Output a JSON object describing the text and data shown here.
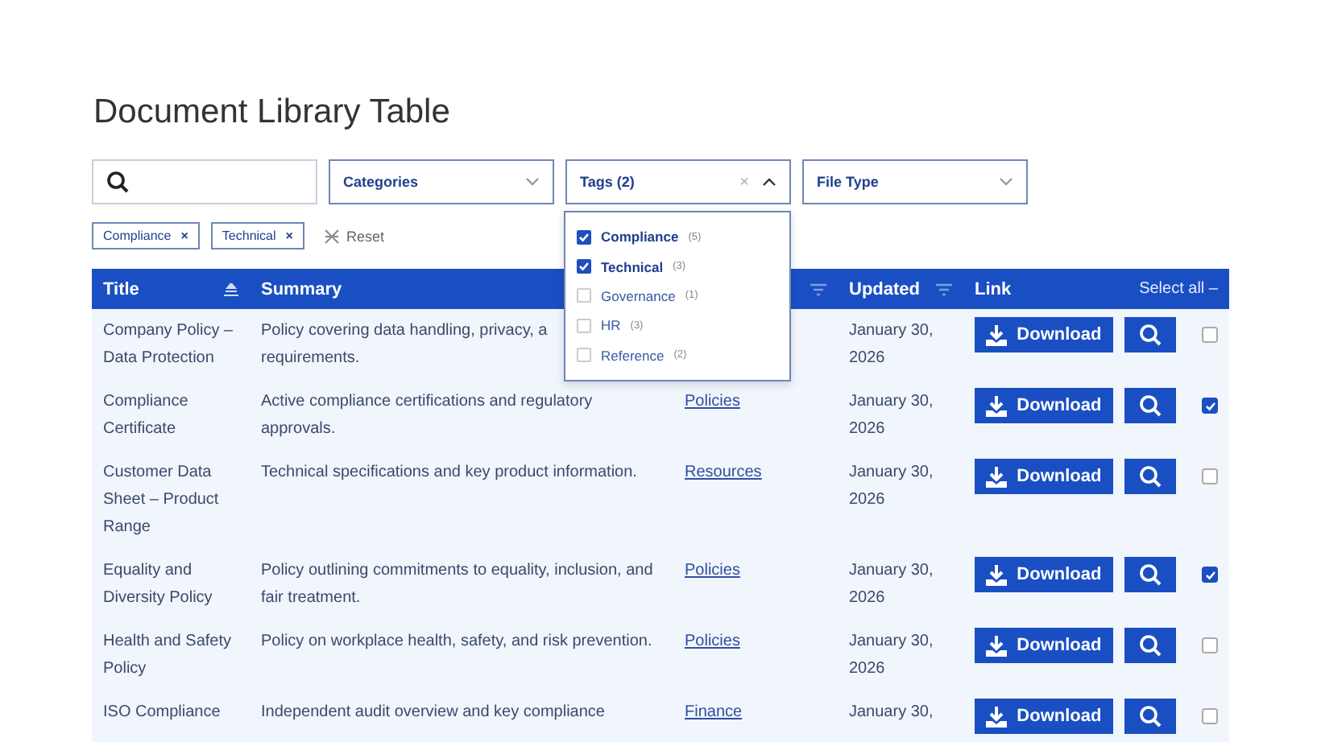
{
  "title": "Document Library Table",
  "filters": {
    "categories": {
      "label": "Categories"
    },
    "tags": {
      "label": "Tags (2)",
      "clear": "×",
      "expanded": true
    },
    "file_type": {
      "label": "File Type"
    }
  },
  "tag_options": [
    {
      "label": "Compliance",
      "count": "(5)",
      "checked": true
    },
    {
      "label": "Technical",
      "count": "(3)",
      "checked": true
    },
    {
      "label": "Governance",
      "count": "(1)",
      "checked": false
    },
    {
      "label": "HR",
      "count": "(3)",
      "checked": false
    },
    {
      "label": "Reference",
      "count": "(2)",
      "checked": false
    }
  ],
  "active_chips": [
    {
      "label": "Compliance",
      "remove": "×"
    },
    {
      "label": "Technical",
      "remove": "×"
    }
  ],
  "reset": "Reset",
  "table": {
    "columns": [
      {
        "label": "Title"
      },
      {
        "label": "Summary"
      },
      {},
      {
        "label": "Updated"
      },
      {
        "label": "Link"
      }
    ],
    "select_all": "Select all –",
    "rows": [
      {
        "title": "Company Policy – Data Protection",
        "summary": "Policy covering data handling, privacy, a\nrequirements.",
        "updated": "January 30, 2026",
        "download": "Download",
        "checked": false
      },
      {
        "title": "Compliance Certificate",
        "summary": "Active compliance certifications and regulatory approvals.",
        "category": "Policies",
        "updated": "January 30, 2026",
        "download": "Download",
        "checked": true
      },
      {
        "title": "Customer Data Sheet – Product Range",
        "summary": "Technical specifications and key product information.",
        "category": "Resources",
        "updated": "January 30, 2026",
        "download": "Download",
        "checked": false
      },
      {
        "title": "Equality and Diversity Policy",
        "summary": "Policy outlining commitments to equality, inclusion, and fair treatment.",
        "category": "Policies",
        "updated": "January 30, 2026",
        "download": "Download",
        "checked": true
      },
      {
        "title": "Health and Safety Policy",
        "summary": "Policy on workplace health, safety, and risk prevention.",
        "category": "Policies",
        "updated": "January 30, 2026",
        "download": "Download",
        "checked": false
      },
      {
        "title": "ISO Compliance",
        "summary": "Independent audit overview and key compliance",
        "category": "Finance",
        "updated": "January 30,",
        "download": "Download",
        "checked": false
      }
    ]
  }
}
